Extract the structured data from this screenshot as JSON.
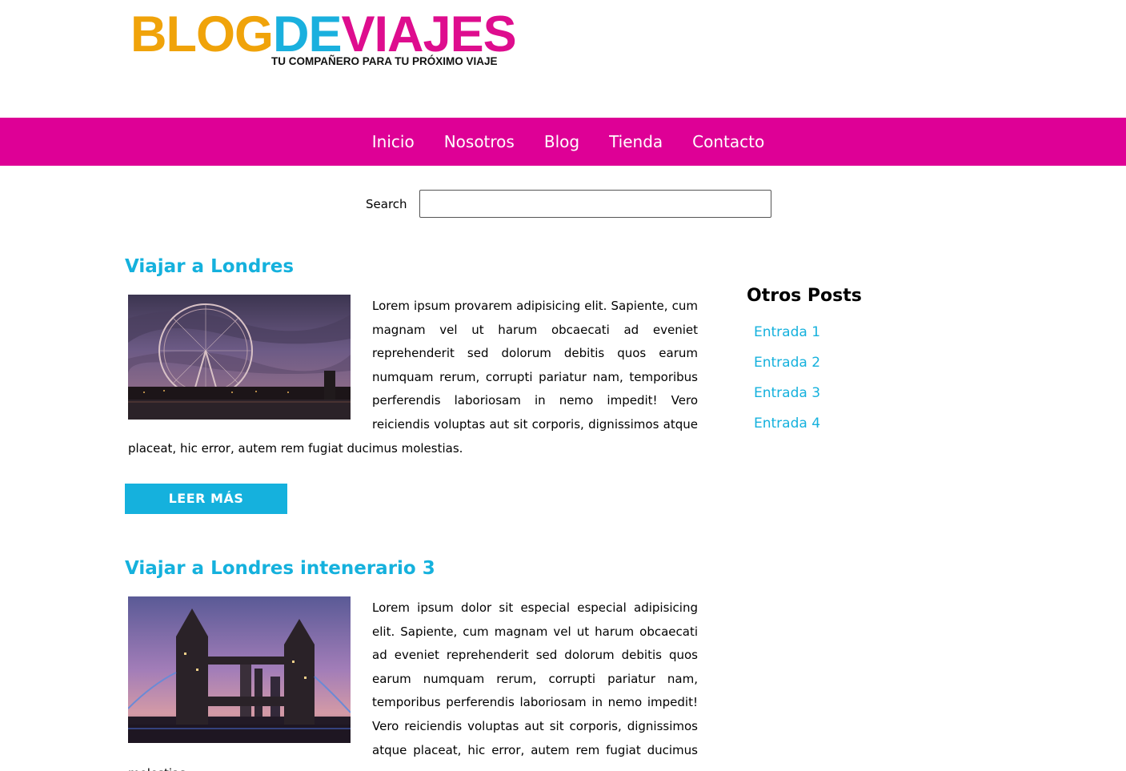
{
  "header": {
    "logo": {
      "blog": "BLOG",
      "de": "DE",
      "viajes": "VIAJES",
      "tagline": "TU COMPAÑERO PARA TU PRÓXIMO VIAJE"
    },
    "colors": {
      "orange": "#f0a30a",
      "blue": "#1ab0de",
      "magenta": "#de0096"
    }
  },
  "nav": {
    "items": [
      {
        "label": "Inicio"
      },
      {
        "label": "Nosotros"
      },
      {
        "label": "Blog"
      },
      {
        "label": "Tienda"
      },
      {
        "label": "Contacto"
      }
    ]
  },
  "search": {
    "label": "Search",
    "value": "",
    "placeholder": ""
  },
  "posts": [
    {
      "title": "Viajar a Londres",
      "image_icon": "london-eye-photo",
      "body": "Lorem ipsum provarem adipisicing elit. Sapiente, cum magnam vel ut harum obcaecati ad eveniet reprehenderit sed dolorum debitis quos earum numquam rerum, corrupti pariatur nam, temporibus perferendis laboriosam in nemo impedit! Vero reiciendis voluptas aut sit corporis, dignissimos atque placeat, hic error, autem rem fugiat ducimus molestias.",
      "button": "LEER MÁS"
    },
    {
      "title": "Viajar a Londres intenerario 3",
      "image_icon": "tower-bridge-photo",
      "body": "Lorem ipsum dolor sit especial especial adipisicing elit. Sapiente, cum magnam vel ut harum obcaecati ad eveniet reprehenderit sed dolorum debitis quos earum numquam rerum, corrupti pariatur nam, temporibus perferendis laboriosam in nemo impedit! Vero reiciendis voluptas aut sit corporis, dignissimos atque placeat, hic error, autem rem fugiat ducimus molestias."
    }
  ],
  "sidebar": {
    "title": "Otros Posts",
    "links": [
      {
        "label": "Entrada 1"
      },
      {
        "label": "Entrada 2"
      },
      {
        "label": "Entrada 3"
      },
      {
        "label": "Entrada 4"
      }
    ]
  }
}
